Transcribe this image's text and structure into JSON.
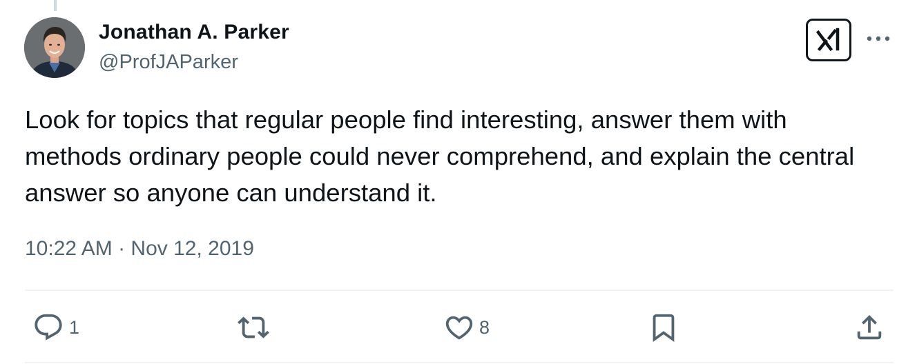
{
  "author": {
    "display_name": "Jonathan A. Parker",
    "handle": "@ProfJAParker",
    "avatar_icon": "profile-photo"
  },
  "header_actions": {
    "grok_icon": "grok-icon",
    "more_icon": "more-horizontal-icon"
  },
  "tweet": {
    "text": "Look for topics that regular people find interesting, answer them with methods ordinary people could never comprehend, and explain the central answer so anyone can understand it.",
    "timestamp": "10:22 AM · Nov 12, 2019"
  },
  "actions": {
    "reply": {
      "icon": "reply-icon",
      "count": "1"
    },
    "retweet": {
      "icon": "retweet-icon",
      "count": ""
    },
    "like": {
      "icon": "heart-icon",
      "count": "8"
    },
    "bookmark": {
      "icon": "bookmark-icon"
    },
    "share": {
      "icon": "share-icon"
    }
  },
  "colors": {
    "text_primary": "#0f1419",
    "text_secondary": "#536471",
    "divider": "#eff3f4"
  }
}
